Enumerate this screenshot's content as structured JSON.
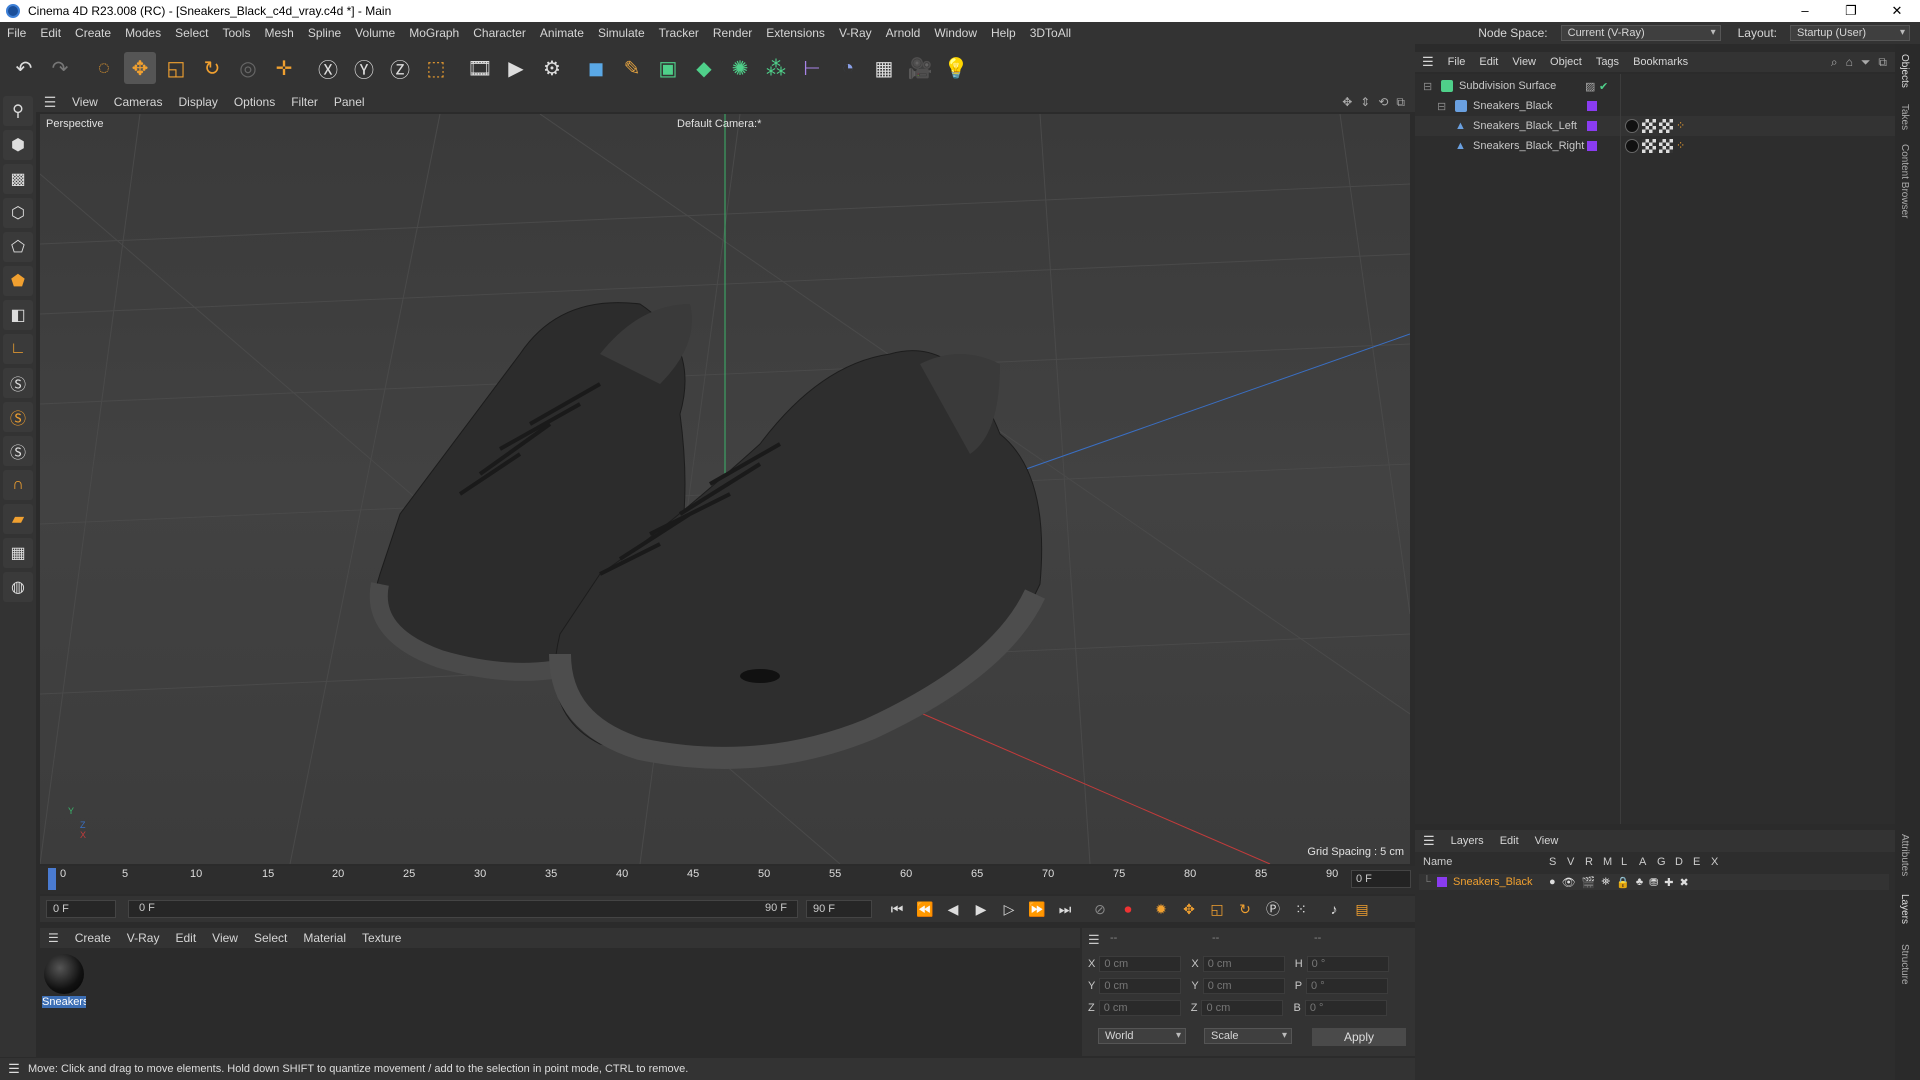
{
  "window": {
    "title": "Cinema 4D R23.008 (RC) - [Sneakers_Black_c4d_vray.c4d *] - Main",
    "controls": [
      "–",
      "❐",
      "✕"
    ]
  },
  "menubar": {
    "items": [
      "File",
      "Edit",
      "Create",
      "Modes",
      "Select",
      "Tools",
      "Mesh",
      "Spline",
      "Volume",
      "MoGraph",
      "Character",
      "Animate",
      "Simulate",
      "Tracker",
      "Render",
      "Extensions",
      "V-Ray",
      "Arnold",
      "Window",
      "Help",
      "3DToAll"
    ],
    "node_space_label": "Node Space:",
    "node_space_value": "Current (V-Ray)",
    "layout_label": "Layout:",
    "layout_value": "Startup (User)"
  },
  "viewport": {
    "menu": [
      "View",
      "Cameras",
      "Display",
      "Options",
      "Filter",
      "Panel"
    ],
    "label": "Perspective",
    "camera": "Default Camera:*",
    "grid_spacing": "Grid Spacing : 5 cm",
    "axis": {
      "y": "Y",
      "z": "Z",
      "x": "X"
    }
  },
  "timeline": {
    "ticks": [
      "0",
      "5",
      "10",
      "15",
      "20",
      "25",
      "30",
      "35",
      "40",
      "45",
      "50",
      "55",
      "60",
      "65",
      "70",
      "75",
      "80",
      "85",
      "90"
    ],
    "current_frame": "0 F"
  },
  "transport": {
    "start": "0 F",
    "range_start": "0 F",
    "range_end": "90 F",
    "end": "90 F"
  },
  "material_manager": {
    "menu": [
      "Create",
      "V-Ray",
      "Edit",
      "View",
      "Select",
      "Material",
      "Texture"
    ],
    "materials": [
      {
        "name": "Sneakers"
      }
    ]
  },
  "coordinates": {
    "header": [
      "--",
      "--",
      "--"
    ],
    "rows": [
      {
        "a": "X",
        "av": "0 cm",
        "b": "X",
        "bv": "0 cm",
        "c": "H",
        "cv": "0 °"
      },
      {
        "a": "Y",
        "av": "0 cm",
        "b": "Y",
        "bv": "0 cm",
        "c": "P",
        "cv": "0 °"
      },
      {
        "a": "Z",
        "av": "0 cm",
        "b": "Z",
        "bv": "0 cm",
        "c": "B",
        "cv": "0 °"
      }
    ],
    "mode": "World",
    "scale": "Scale",
    "apply": "Apply"
  },
  "statusbar": {
    "text": "Move: Click and drag to move elements. Hold down SHIFT to quantize movement / add to the selection in point mode, CTRL to remove."
  },
  "object_manager": {
    "menu": [
      "File",
      "Edit",
      "View",
      "Object",
      "Tags",
      "Bookmarks"
    ],
    "objects": [
      {
        "name": "Subdivision Surface",
        "indent": 0
      },
      {
        "name": "Sneakers_Black",
        "indent": 1
      },
      {
        "name": "Sneakers_Black_Left",
        "indent": 2
      },
      {
        "name": "Sneakers_Black_Right",
        "indent": 2
      }
    ]
  },
  "layer_manager": {
    "menu": [
      "Layers",
      "Edit",
      "View"
    ],
    "columns": [
      "Name",
      "S",
      "V",
      "R",
      "M",
      "L",
      "A",
      "G",
      "D",
      "E",
      "X"
    ],
    "layers": [
      {
        "name": "Sneakers_Black",
        "color": "#8a3cf0"
      }
    ]
  },
  "side_tabs": [
    "Objects",
    "Takes",
    "Content Browser",
    "Attributes",
    "Layers",
    "Structure"
  ],
  "colors": {
    "accent": "#3d6fb5",
    "layer": "#8a3cf0",
    "x_axis": "#c23b3b",
    "y_axis": "#3bb46a",
    "z_axis": "#3a6fc4"
  }
}
